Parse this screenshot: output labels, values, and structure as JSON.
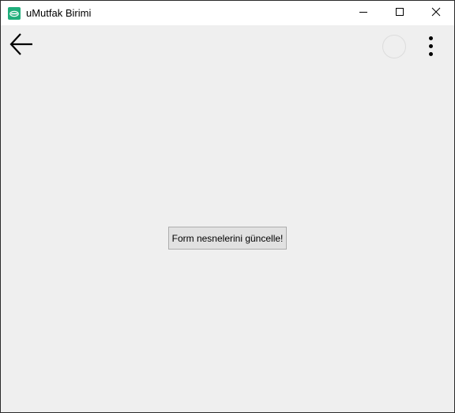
{
  "window": {
    "title": "uMutfak Birimi",
    "app_icon": "umutfak-app-icon",
    "controls": {
      "minimize_icon": "minimize-icon",
      "maximize_icon": "maximize-icon",
      "close_icon": "close-icon"
    }
  },
  "toolbar": {
    "back_icon": "arrow-left-icon",
    "loading_icon": "spinner-icon",
    "more_icon": "more-vertical-icon"
  },
  "main": {
    "update_button_label": "Form nesnelerini güncelle!"
  },
  "colors": {
    "titlebar_bg": "#ffffff",
    "content_bg": "#efefef",
    "button_bg": "#e1e1e1",
    "button_border": "#adadad",
    "app_icon_green": "#1fae7b",
    "window_border": "#2b2b2b"
  }
}
